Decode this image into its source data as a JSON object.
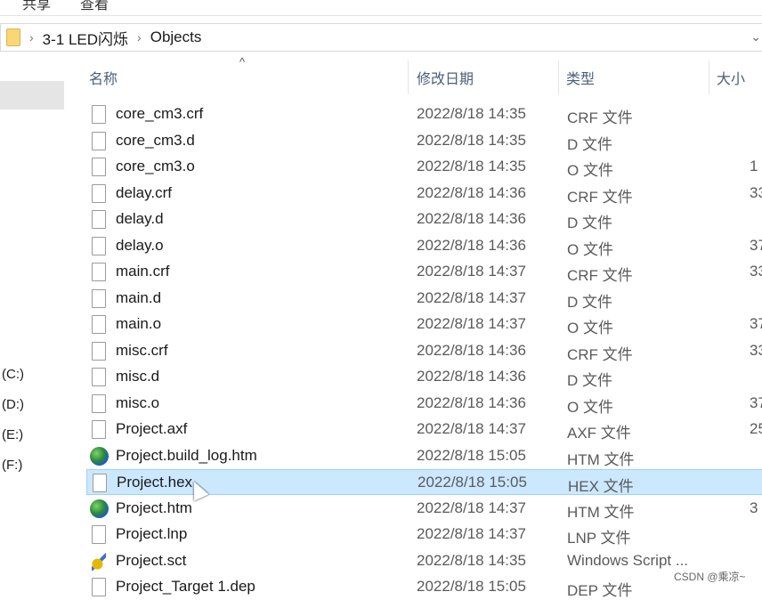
{
  "menu": [
    "共享",
    "查看"
  ],
  "breadcrumb": [
    "3-1 LED闪烁",
    "Objects"
  ],
  "columns": {
    "name": "名称",
    "date": "修改日期",
    "type": "类型",
    "size": "大小"
  },
  "nav": {
    "drives": [
      "(C:)",
      "(D:)",
      "(E:)",
      "(F:)"
    ]
  },
  "files": [
    {
      "name": "core_cm3.crf",
      "date": "2022/8/18 14:35",
      "type": "CRF 文件",
      "size": "",
      "icon": "file"
    },
    {
      "name": "core_cm3.d",
      "date": "2022/8/18 14:35",
      "type": "D 文件",
      "size": "",
      "icon": "file"
    },
    {
      "name": "core_cm3.o",
      "date": "2022/8/18 14:35",
      "type": "O 文件",
      "size": "1",
      "icon": "file"
    },
    {
      "name": "delay.crf",
      "date": "2022/8/18 14:36",
      "type": "CRF 文件",
      "size": "33",
      "icon": "file"
    },
    {
      "name": "delay.d",
      "date": "2022/8/18 14:36",
      "type": "D 文件",
      "size": "",
      "icon": "file"
    },
    {
      "name": "delay.o",
      "date": "2022/8/18 14:36",
      "type": "O 文件",
      "size": "37",
      "icon": "file"
    },
    {
      "name": "main.crf",
      "date": "2022/8/18 14:37",
      "type": "CRF 文件",
      "size": "33",
      "icon": "file"
    },
    {
      "name": "main.d",
      "date": "2022/8/18 14:37",
      "type": "D 文件",
      "size": "",
      "icon": "file"
    },
    {
      "name": "main.o",
      "date": "2022/8/18 14:37",
      "type": "O 文件",
      "size": "37",
      "icon": "file"
    },
    {
      "name": "misc.crf",
      "date": "2022/8/18 14:36",
      "type": "CRF 文件",
      "size": "33",
      "icon": "file"
    },
    {
      "name": "misc.d",
      "date": "2022/8/18 14:36",
      "type": "D 文件",
      "size": "",
      "icon": "file"
    },
    {
      "name": "misc.o",
      "date": "2022/8/18 14:36",
      "type": "O 文件",
      "size": "37",
      "icon": "file"
    },
    {
      "name": "Project.axf",
      "date": "2022/8/18 14:37",
      "type": "AXF 文件",
      "size": "25",
      "icon": "file"
    },
    {
      "name": "Project.build_log.htm",
      "date": "2022/8/18 15:05",
      "type": "HTM 文件",
      "size": "",
      "icon": "globe"
    },
    {
      "name": "Project.hex",
      "date": "2022/8/18 15:05",
      "type": "HEX 文件",
      "size": "",
      "icon": "file",
      "selected": true
    },
    {
      "name": "Project.htm",
      "date": "2022/8/18 14:37",
      "type": "HTM 文件",
      "size": "3",
      "icon": "globe"
    },
    {
      "name": "Project.lnp",
      "date": "2022/8/18 14:37",
      "type": "LNP 文件",
      "size": "",
      "icon": "file"
    },
    {
      "name": "Project.sct",
      "date": "2022/8/18 14:35",
      "type": "Windows Script ...",
      "size": "",
      "icon": "script"
    },
    {
      "name": "Project_Target 1.dep",
      "date": "2022/8/18 15:05",
      "type": "DEP 文件",
      "size": "",
      "icon": "file"
    }
  ],
  "watermark": "CSDN @乘凉~"
}
